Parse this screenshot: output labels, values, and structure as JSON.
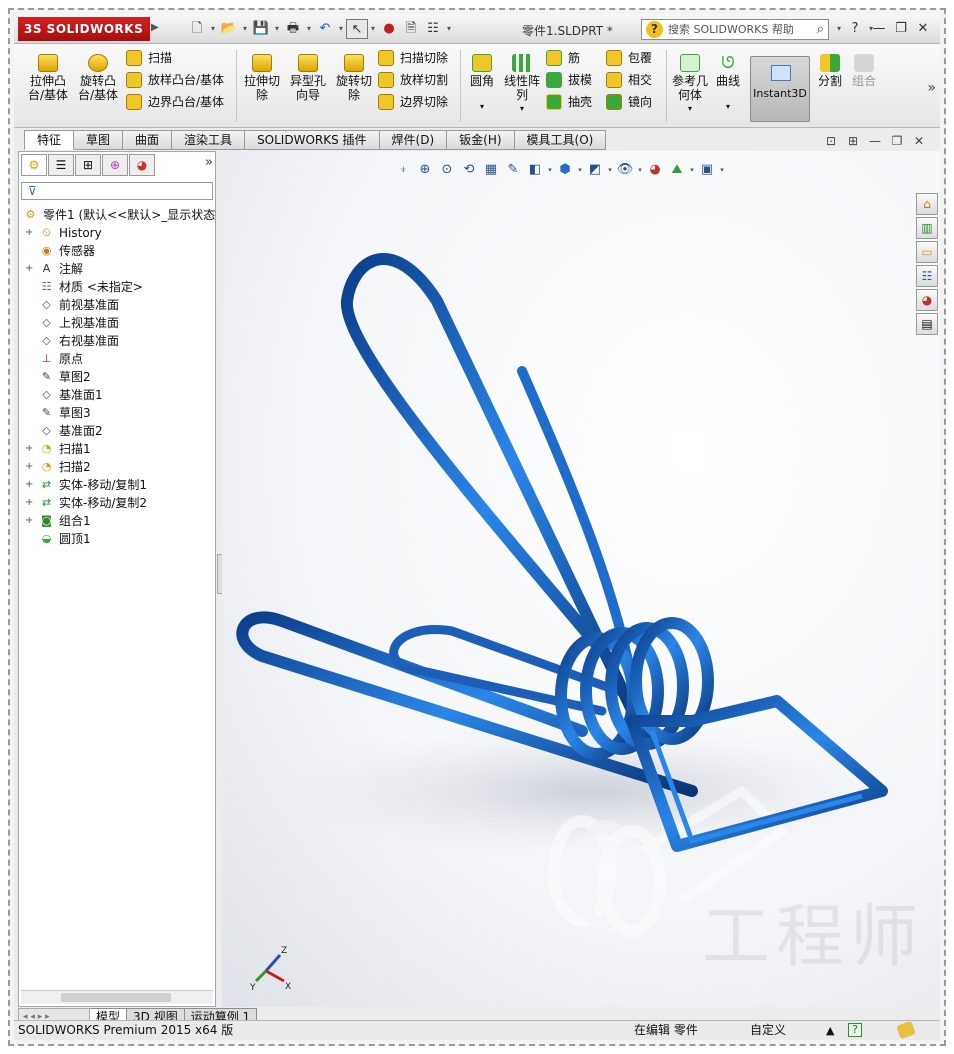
{
  "app": {
    "brand": "SOLIDWORKS",
    "document_title": "零件1.SLDPRT *",
    "search_placeholder": "搜索 SOLIDWORKS 帮助"
  },
  "ribbon": {
    "extrude_boss": "拉伸凸\n台/基体",
    "revolve_boss": "旋转凸\n台/基体",
    "sweep": "扫描",
    "loft_boss": "放样凸台/基体",
    "boundary_boss": "边界凸台/基体",
    "extrude_cut": "拉伸切\n除",
    "hole_wizard": "异型孔\n向导",
    "revolve_cut": "旋转切\n除",
    "swept_cut": "扫描切除",
    "lofted_cut": "放样切割",
    "boundary_cut": "边界切除",
    "fillet": "圆角",
    "linear_pattern": "线性阵\n列",
    "rib": "筋",
    "draft": "拔模",
    "shell": "抽壳",
    "wrap": "包覆",
    "intersect": "相交",
    "mirror": "镜向",
    "ref_geometry": "参考几\n何体",
    "curves": "曲线",
    "instant3d": "Instant3D",
    "split": "分割",
    "combine": "组合"
  },
  "tabs": [
    "特征",
    "草图",
    "曲面",
    "渲染工具",
    "SOLIDWORKS 插件",
    "焊件(D)",
    "钣金(H)",
    "模具工具(O)"
  ],
  "active_tab": "特征",
  "feature_tree": {
    "root": "零件1 (默认<<默认>_显示状态",
    "items": [
      {
        "label": "History",
        "icon": "history-icon",
        "expand": "+"
      },
      {
        "label": "传感器",
        "icon": "sensor-icon",
        "expand": ""
      },
      {
        "label": "注解",
        "icon": "annotation-icon",
        "expand": "+"
      },
      {
        "label": "材质 <未指定>",
        "icon": "material-icon",
        "expand": ""
      },
      {
        "label": "前视基准面",
        "icon": "plane-icon",
        "expand": ""
      },
      {
        "label": "上视基准面",
        "icon": "plane-icon",
        "expand": ""
      },
      {
        "label": "右视基准面",
        "icon": "plane-icon",
        "expand": ""
      },
      {
        "label": "原点",
        "icon": "origin-icon",
        "expand": ""
      },
      {
        "label": "草图2",
        "icon": "sketch-icon",
        "expand": ""
      },
      {
        "label": "基准面1",
        "icon": "plane-icon",
        "expand": ""
      },
      {
        "label": "草图3",
        "icon": "sketch-icon",
        "expand": ""
      },
      {
        "label": "基准面2",
        "icon": "plane-icon",
        "expand": ""
      },
      {
        "label": "扫描1",
        "icon": "sweep-icon",
        "expand": "+"
      },
      {
        "label": "扫描2",
        "icon": "sweep-icon",
        "expand": "+"
      },
      {
        "label": "实体-移动/复制1",
        "icon": "move-body-icon",
        "expand": "+"
      },
      {
        "label": "实体-移动/复制2",
        "icon": "move-body-icon",
        "expand": "+"
      },
      {
        "label": "组合1",
        "icon": "combine-icon",
        "expand": "+"
      },
      {
        "label": "圆顶1",
        "icon": "dome-icon",
        "expand": ""
      }
    ]
  },
  "bottom_tabs": [
    "模型",
    "3D 视图",
    "运动算例 1"
  ],
  "active_bottom_tab": "模型",
  "status": {
    "product": "SOLIDWORKS Premium 2015 x64 版",
    "mode": "在编辑 零件",
    "units": "自定义",
    "units_arrow": "▲"
  },
  "watermark": "工程师",
  "triad_labels": {
    "x": "X",
    "y": "Y",
    "z": "Z"
  },
  "colors": {
    "accent_red": "#c41616",
    "model_blue": "#1e6fd0",
    "ribbon_icon_yellow": "#f0c628",
    "ribbon_icon_green": "#3aa83a"
  }
}
